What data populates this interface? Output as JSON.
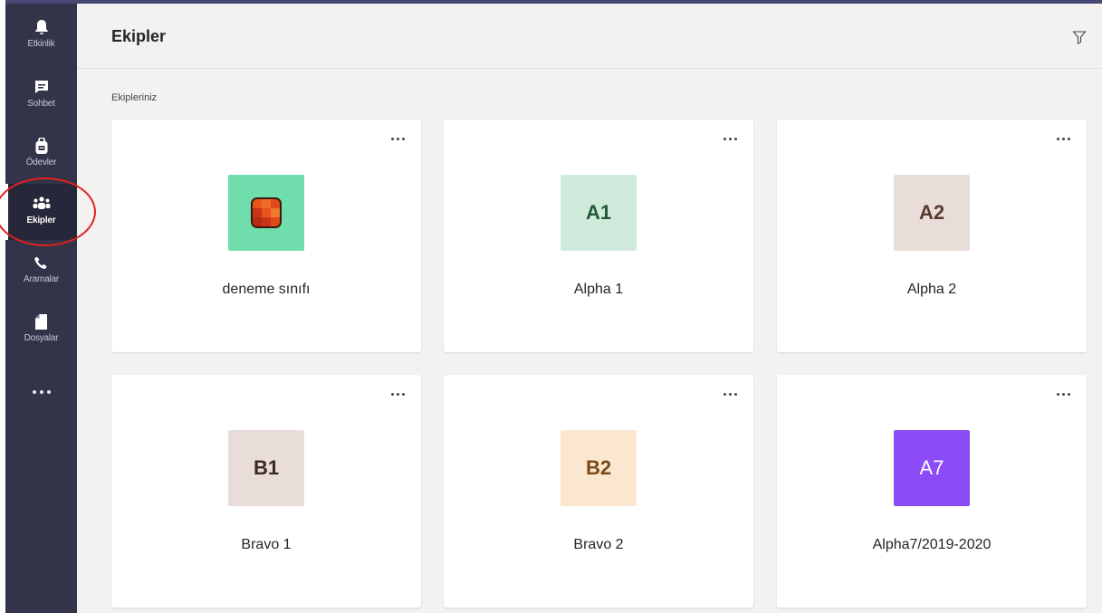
{
  "rail": {
    "items": [
      {
        "label": "Etkinlik",
        "icon": "bell-icon"
      },
      {
        "label": "Sohbet",
        "icon": "chat-icon"
      },
      {
        "label": "Ödevler",
        "icon": "assignments-icon"
      },
      {
        "label": "Ekipler",
        "icon": "teams-icon",
        "active": true
      },
      {
        "label": "Aramalar",
        "icon": "phone-icon"
      },
      {
        "label": "Dosyalar",
        "icon": "file-icon"
      }
    ],
    "more_icon": "more-horizontal-icon"
  },
  "header": {
    "title": "Ekipler",
    "filter_icon": "filter-icon"
  },
  "section": {
    "label": "Ekipleriniz"
  },
  "teams": [
    {
      "name": "deneme sınıfı",
      "avatar_text": "",
      "avatar_bg": "#6fddac",
      "avatar_fg": "#ffffff",
      "avatar_icon": "orange-square-logo-icon"
    },
    {
      "name": "Alpha 1",
      "avatar_text": "A1",
      "avatar_bg": "#d0ebdc",
      "avatar_fg": "#235a38"
    },
    {
      "name": "Alpha 2",
      "avatar_text": "A2",
      "avatar_bg": "#e8ddd9",
      "avatar_fg": "#5a3a30"
    },
    {
      "name": "Bravo 1",
      "avatar_text": "B1",
      "avatar_bg": "#e8ddd9",
      "avatar_fg": "#3a2a25"
    },
    {
      "name": "Bravo 2",
      "avatar_text": "B2",
      "avatar_bg": "#fbe6cf",
      "avatar_fg": "#7a4a1a"
    },
    {
      "name": "Alpha7/2019-2020",
      "avatar_text": "A7",
      "avatar_bg": "#8b4cf7",
      "avatar_fg": "#ffffff"
    }
  ],
  "colors": {
    "rail_bg": "#33344a",
    "accent": "#464775",
    "annotation": "#e0201f"
  }
}
